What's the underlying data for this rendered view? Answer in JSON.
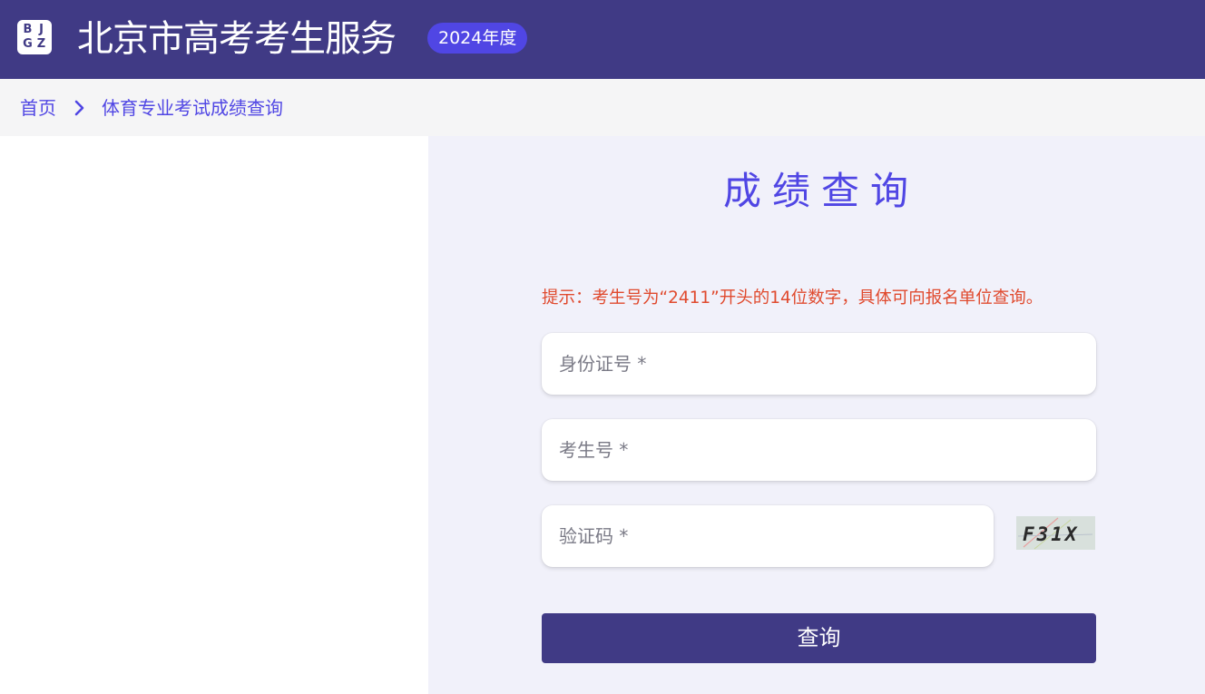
{
  "header": {
    "logo_letters": [
      "B",
      "J",
      "G",
      "Z"
    ],
    "title": "北京市高考考生服务",
    "year_badge": "2024年度",
    "colors": {
      "background": "#403a85",
      "badge": "#5046e4"
    }
  },
  "breadcrumb": {
    "home": "首页",
    "separator_icon": "chevron-right-icon",
    "current": "体育专业考试成绩查询"
  },
  "form": {
    "title": "成绩查询",
    "hint": "提示：考生号为“2411”开头的14位数字，具体可向报名单位查询。",
    "id_card": {
      "placeholder": "身份证号 *",
      "value": ""
    },
    "exam_number": {
      "placeholder": "考生号 *",
      "value": ""
    },
    "captcha": {
      "placeholder": "验证码 *",
      "value": "",
      "image_text": "F31X"
    },
    "submit_label": "查询",
    "colors": {
      "accent": "#5046e4",
      "hint": "#e04a2e",
      "button": "#403a85",
      "panel": "#f1f1fa"
    }
  }
}
